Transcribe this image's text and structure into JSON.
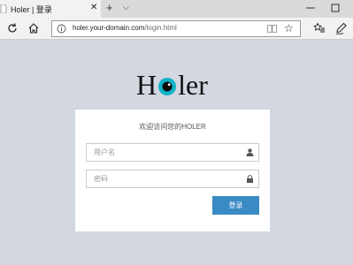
{
  "browser": {
    "tab_title": "Holer | 登录",
    "tab_close": "✕",
    "new_tab": "+",
    "tab_menu": "⌵",
    "url_domain": "holer.your-domain.com",
    "url_path": "/login.html",
    "star": "☆",
    "icons": [
      "refresh-icon",
      "home-icon",
      "info-icon",
      "reading-view-icon",
      "favorite-star-icon",
      "favorites-hub-icon",
      "pen-icon",
      "minimize-icon",
      "maximize-icon"
    ]
  },
  "page": {
    "logo_left": "H",
    "logo_right": "ler",
    "logo_eye_color": "#12b3c8",
    "welcome": "欢迎访问您的HOLER",
    "username_placeholder": "用户名",
    "password_placeholder": "密码",
    "login_label": "登录",
    "accent_color": "#3a8ac4",
    "background_color": "#d2d7e0"
  }
}
